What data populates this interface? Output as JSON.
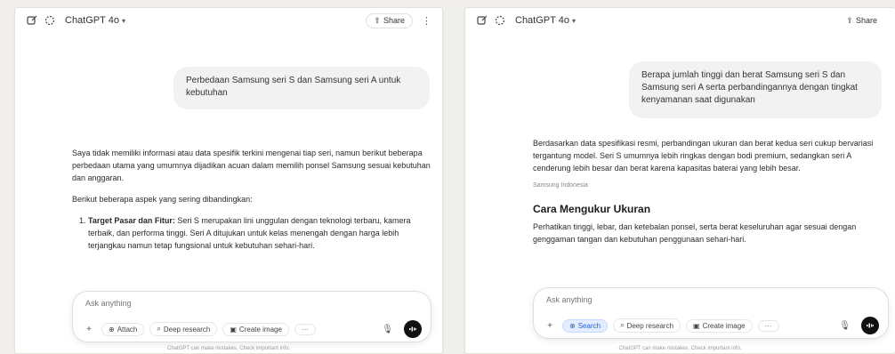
{
  "left": {
    "model_name": "ChatGPT 4o",
    "share_label": "Share",
    "user_message": "Perbedaan Samsung seri S dan Samsung seri A untuk kebutuhan",
    "response_intro": "Saya tidak memiliki informasi atau data spesifik terkini mengenai tiap seri, namun berikut beberapa perbedaan utama yang umumnya dijadikan acuan dalam memilih ponsel Samsung sesuai kebutuhan dan anggaran.",
    "response_lead": "Berikut beberapa aspek yang sering dibandingkan:",
    "list_title": "Target Pasar dan Fitur:",
    "list_text": "Seri S merupakan lini unggulan dengan teknologi terbaru, kamera terbaik, dan performa tinggi. Seri A ditujukan untuk kelas menengah dengan harga lebih terjangkau namun tetap fungsional untuk kebutuhan sehari-hari.",
    "composer_placeholder": "Ask anything",
    "tool_attach": "Attach",
    "tool_search": "Deep research",
    "tool_image": "Create image",
    "disclaimer": "ChatGPT can make mistakes. Check important info."
  },
  "right": {
    "model_name": "ChatGPT 4o",
    "share_label": "Share",
    "user_message": "Berapa jumlah tinggi dan berat Samsung seri S dan Samsung seri A serta perbandingannya dengan tingkat kenyamanan saat digunakan",
    "response_text": "Berdasarkan data spesifikasi resmi, perbandingan ukuran dan berat kedua seri cukup bervariasi tergantung model. Seri S umumnya lebih ringkas dengan bodi premium, sedangkan seri A cenderung lebih besar dan berat karena kapasitas baterai yang lebih besar.",
    "source_chip": "Samsung Indonesia",
    "section_title": "Cara Mengukur Ukuran",
    "section_text": "Perhatikan tinggi, lebar, dan ketebalan ponsel, serta berat keseluruhan agar sesuai dengan genggaman tangan dan kebutuhan penggunaan sehari-hari.",
    "composer_placeholder": "Ask anything",
    "tool_attach": "Search",
    "tool_search": "Deep research",
    "tool_image": "Create image",
    "disclaimer": "ChatGPT can make mistakes. Check important info."
  }
}
